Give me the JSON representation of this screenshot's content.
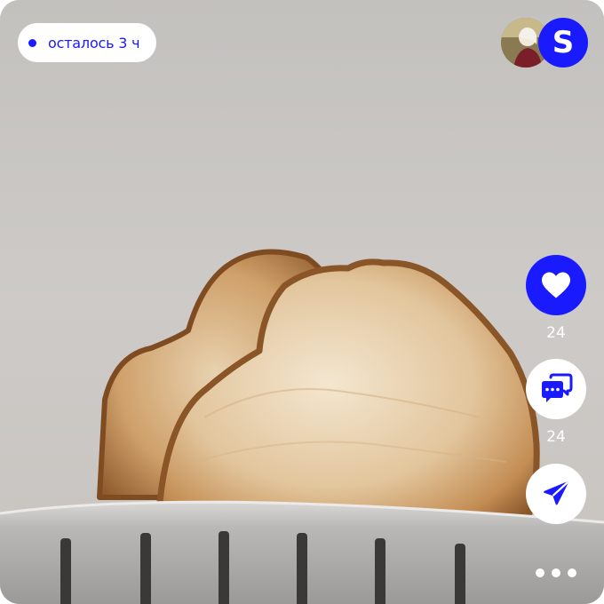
{
  "timer": {
    "text": "осталось 3 ч",
    "color": "#1a1aff"
  },
  "author": {
    "avatar_icon": "user-photo",
    "brand_letter": "S",
    "brand_color": "#1a1aff"
  },
  "actions": {
    "like": {
      "icon": "heart-icon",
      "count": "24"
    },
    "comment": {
      "icon": "chat-bubbles-icon",
      "count": "24"
    },
    "share": {
      "icon": "paper-plane-icon"
    },
    "more": {
      "icon": "more-dots-icon"
    }
  }
}
